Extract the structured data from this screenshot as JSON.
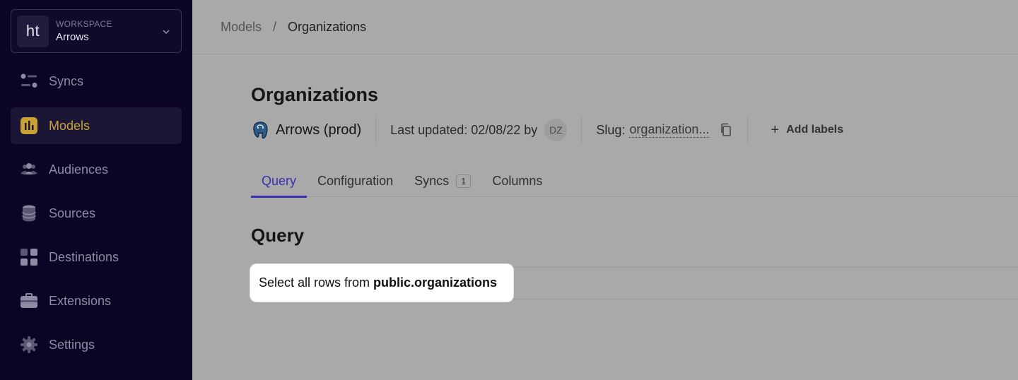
{
  "workspace": {
    "logo_text": "ht",
    "caption": "WORKSPACE",
    "name": "Arrows"
  },
  "sidebar": {
    "items": [
      {
        "label": "Syncs",
        "icon": "syncs-icon",
        "active": false
      },
      {
        "label": "Models",
        "icon": "models-icon",
        "active": true
      },
      {
        "label": "Audiences",
        "icon": "audiences-icon",
        "active": false
      },
      {
        "label": "Sources",
        "icon": "database-icon",
        "active": false
      },
      {
        "label": "Destinations",
        "icon": "grid-icon",
        "active": false
      },
      {
        "label": "Extensions",
        "icon": "briefcase-icon",
        "active": false
      },
      {
        "label": "Settings",
        "icon": "gear-icon",
        "active": false
      }
    ]
  },
  "breadcrumb": {
    "parent": "Models",
    "separator": "/",
    "current": "Organizations"
  },
  "page": {
    "title": "Organizations",
    "source_name": "Arrows (prod)",
    "last_updated_label": "Last updated: 02/08/22 by",
    "avatar_initials": "DZ",
    "slug_label": "Slug:",
    "slug_value": "organization...",
    "add_labels": "Add labels"
  },
  "tabs": [
    {
      "label": "Query",
      "active": true
    },
    {
      "label": "Configuration",
      "active": false
    },
    {
      "label": "Syncs",
      "badge": "1",
      "active": false
    },
    {
      "label": "Columns",
      "active": false
    }
  ],
  "query": {
    "section_title": "Query",
    "prefix": "Select all rows from",
    "table": "public.organizations"
  },
  "colors": {
    "sidebar_bg": "#0b0425",
    "active_accent": "#c8a233",
    "tab_accent": "#3b2fb0"
  }
}
